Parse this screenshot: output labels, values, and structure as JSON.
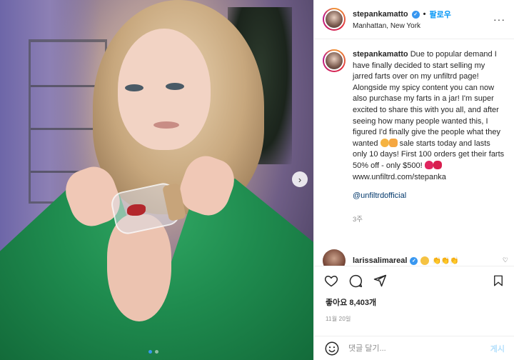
{
  "post": {
    "username": "stepankamatto",
    "follow_label": "팔로우",
    "location": "Manhattan, New York",
    "more_label": "···"
  },
  "caption": {
    "username": "stepankamatto",
    "text_1": "Due to popular demand I have finally decided to start selling my jarred farts over on my unfiltrd page! Alongside my spicy content you can now also purchase my farts in a jar! I'm super excited to share this with you all, and after seeing how many people wanted this, I figured I'd finally give the people what they wanted",
    "text_2": "sale starts today and lasts only 10 days! First 100 orders get their farts 50% off - only $500!",
    "link": "www.unfiltrd.com/stepanka",
    "mention": "@unfiltrdofficial",
    "time": "3주"
  },
  "comment": {
    "username": "larissalimareal"
  },
  "stats": {
    "likes": "좋아요 8,403개",
    "date": "11월 20일"
  },
  "composer": {
    "placeholder": "댓글 달기...",
    "post_label": "게시"
  },
  "carousel": {
    "next_label": "›",
    "slides": 2,
    "active": 1
  },
  "colors": {
    "accent": "#0095f6",
    "verified": "#3897f0",
    "post_disabled": "#b2dffc"
  },
  "icons": [
    "more-icon",
    "verified-icon",
    "heart-icon",
    "comment-icon",
    "share-icon",
    "bookmark-icon",
    "emoji-icon",
    "chevron-right-icon"
  ]
}
